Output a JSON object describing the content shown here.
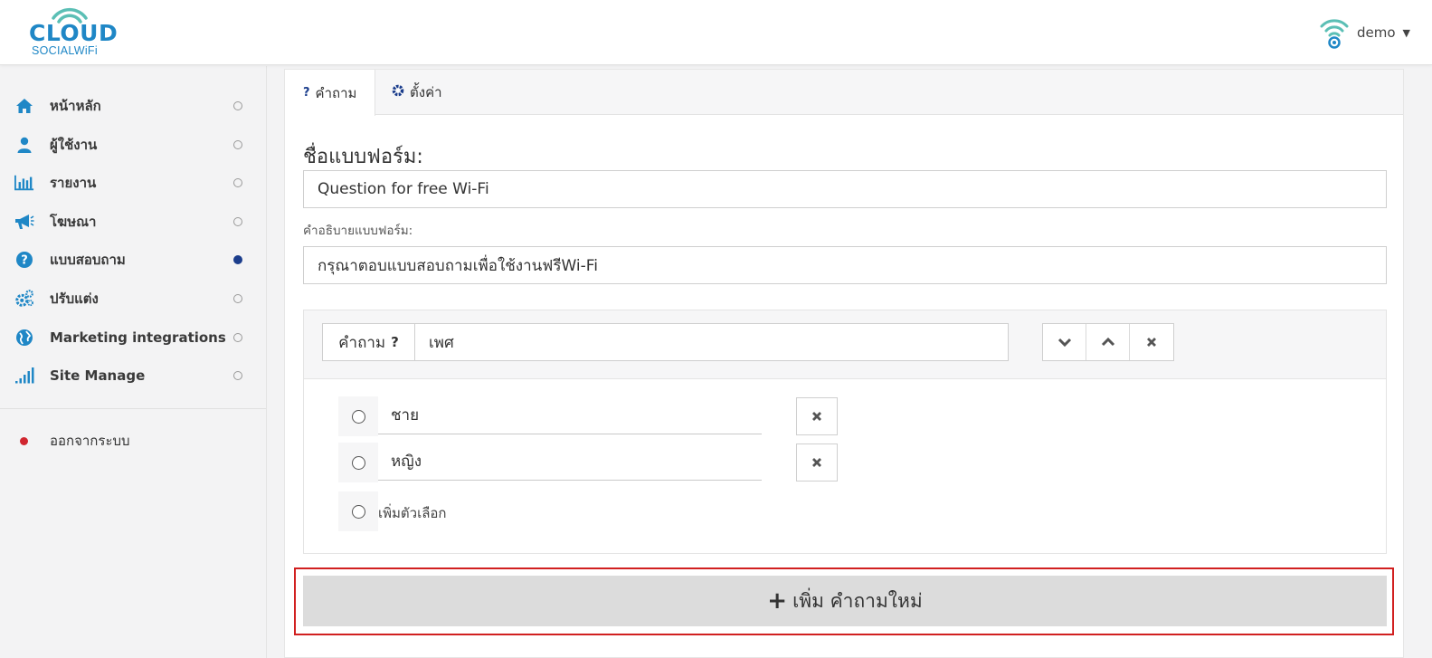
{
  "brand": {
    "logo_word": "CLOUD",
    "logo_sub": "SOCIALWiFi",
    "primary_color": "#1f87c6",
    "accent_color": "#5bbfb5",
    "wifi_icon": "wifi-icon"
  },
  "user": {
    "name": "demo",
    "avatar_icon": "wifi-avatar-icon",
    "caret_icon": "caret-down-icon"
  },
  "sidebar": {
    "items": [
      {
        "label": "หน้าหลัก",
        "icon": "home-icon",
        "active": false
      },
      {
        "label": "ผู้ใช้งาน",
        "icon": "user-icon",
        "active": false
      },
      {
        "label": "รายงาน",
        "icon": "bar-chart-icon",
        "active": false
      },
      {
        "label": "โฆษณา",
        "icon": "bullhorn-icon",
        "active": false
      },
      {
        "label": "แบบสอบถาม",
        "icon": "question-circle-icon",
        "active": true
      },
      {
        "label": "ปรับแต่ง",
        "icon": "gears-icon",
        "active": false
      },
      {
        "label": "Marketing integrations",
        "icon": "globe-icon",
        "active": false
      },
      {
        "label": "Site Manage",
        "icon": "signal-icon",
        "active": false
      }
    ],
    "logout_label": "ออกจากระบบ",
    "active_dot_color": "#1b3d8c",
    "logout_dot_color": "#d0262f"
  },
  "tabs": [
    {
      "label": "คำถาม",
      "icon": "question-mark-icon",
      "active": true
    },
    {
      "label": "ตั้งค่า",
      "icon": "gear-icon",
      "active": false
    }
  ],
  "form": {
    "title_label": "ชื่อแบบฟอร์ม:",
    "title_value": "Question for free Wi-Fi",
    "desc_label": "คำอธิบายแบบฟอร์ม:",
    "desc_value": "กรุณาตอบแบบสอบถามเพื่อใช้งานฟรีWi-Fi"
  },
  "question": {
    "addon_label": "คำถาม",
    "addon_icon": "question-mark-icon",
    "value": "เพศ",
    "actions": [
      "move-down",
      "move-up",
      "delete"
    ],
    "options": [
      {
        "value": "ชาย"
      },
      {
        "value": "หญิง"
      }
    ],
    "add_option_label": "เพิ่มตัวเลือก"
  },
  "add_question": {
    "label": "เพิ่ม คำถามใหม่",
    "icon": "plus-icon",
    "highlight_color": "#d12020"
  }
}
